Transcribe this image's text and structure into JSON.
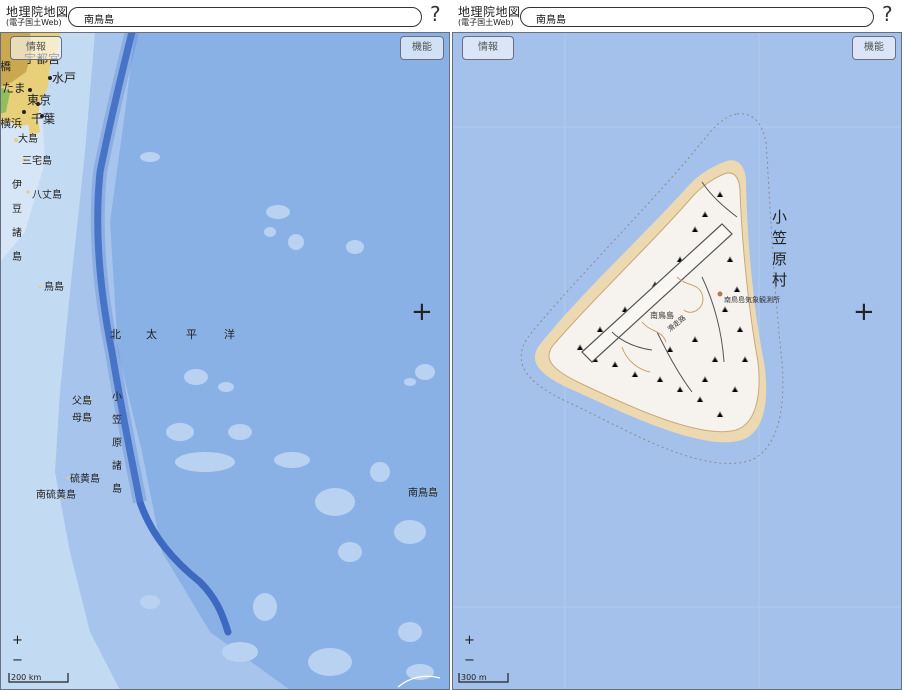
{
  "left": {
    "brand_title": "地理院地図",
    "brand_sub": "(電子国土Web)",
    "search_value": "南鳥島",
    "help": "?",
    "info_label": "情報",
    "function_label": "機能",
    "zoom_in": "+",
    "zoom_out": "−",
    "crosshair": "+",
    "scale_label": "200 km",
    "places": {
      "utsunomiya": "宇都宮",
      "mito": "水戸",
      "tama": "たま",
      "tokyo": "東京",
      "yokohama": "横浜",
      "chiba": "千葉",
      "oshima": "大島",
      "miyake": "三宅島",
      "hachijo": "八丈島",
      "izu_shoto": [
        "伊",
        "豆",
        "諸",
        "島"
      ],
      "torishima": "鳥島",
      "pacific": [
        "北",
        "太",
        "平",
        "洋"
      ],
      "chichijima": "父島",
      "hahajima": "母島",
      "ogasawara_shoto": [
        "小",
        "笠",
        "原",
        "諸",
        "島"
      ],
      "ioto": "硫黄島",
      "minami_ioto": "南硫黄島",
      "minamitorishima": "南鳥島",
      "partial_left": "橋"
    }
  },
  "right": {
    "brand_title": "地理院地図",
    "brand_sub": "(電子国土Web)",
    "search_value": "南鳥島",
    "help": "?",
    "info_label": "情報",
    "function_label": "機能",
    "zoom_in": "+",
    "zoom_out": "−",
    "crosshair": "+",
    "scale_label": "300 m",
    "places": {
      "village": [
        "小",
        "笠",
        "原",
        "村"
      ],
      "island": "南鳥島",
      "weather_station": "南鳥島気象観測所",
      "runway": "滑走路"
    }
  },
  "colors": {
    "deep_ocean": "#7fa9e2",
    "ocean": "#9dbbe9",
    "shelf": "#c6dcf3",
    "trench": "#3f6fc2",
    "land": "#e9d487",
    "island_fill": "#f6f3ee",
    "reef": "#ecd8b0",
    "frame_border": "#6a6f80"
  }
}
